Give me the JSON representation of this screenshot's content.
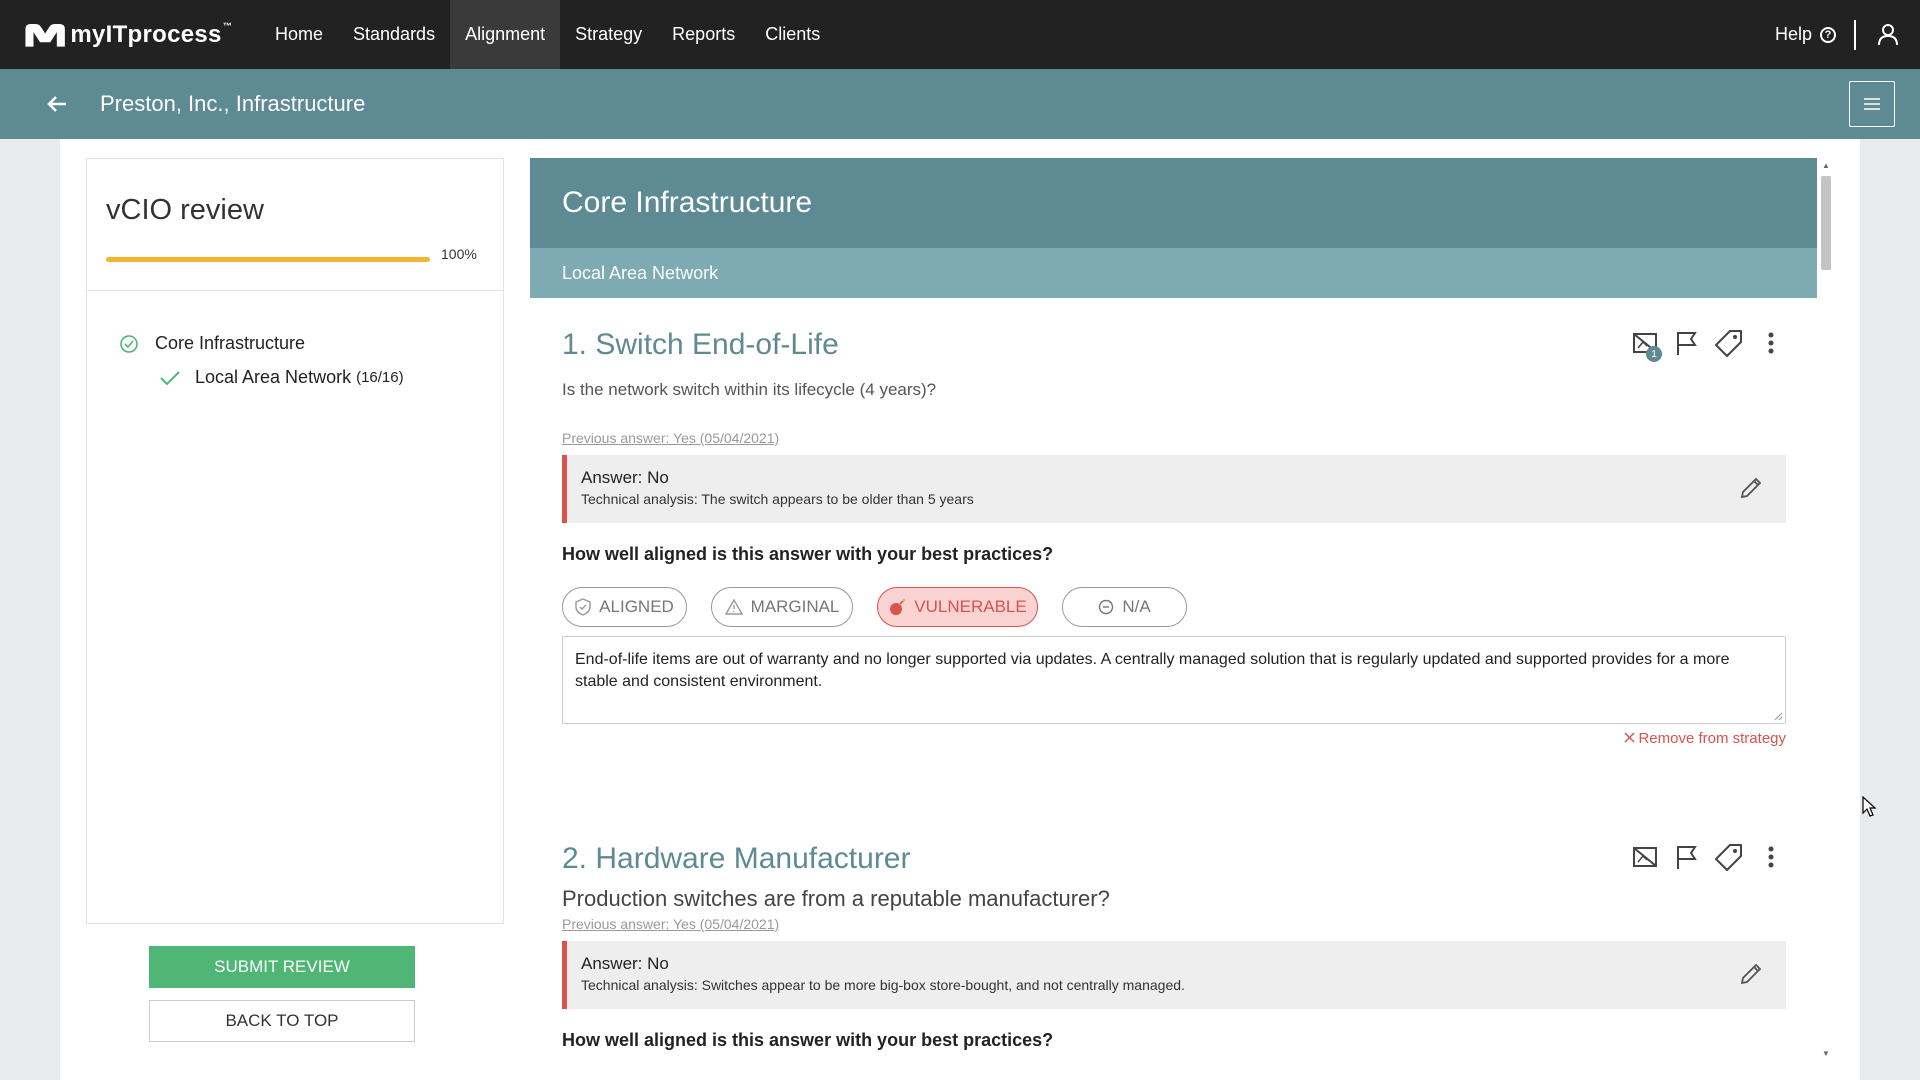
{
  "brand": {
    "name": "myITprocess",
    "tm": "™"
  },
  "nav": {
    "items": [
      {
        "label": "Home"
      },
      {
        "label": "Standards"
      },
      {
        "label": "Alignment"
      },
      {
        "label": "Strategy"
      },
      {
        "label": "Reports"
      },
      {
        "label": "Clients"
      }
    ],
    "active": "Alignment",
    "help_label": "Help"
  },
  "subheader": {
    "title": "Preston, Inc., Infrastructure"
  },
  "sidebar": {
    "title": "vCIO review",
    "progress_percent": 100,
    "progress_label": "100%",
    "tree": {
      "section": "Core Infrastructure",
      "item": "Local Area Network",
      "item_count": "(16/16)"
    },
    "submit_label": "SUBMIT REVIEW",
    "back_to_top_label": "BACK TO TOP"
  },
  "main": {
    "section_title": "Core Infrastructure",
    "subsection_title": "Local Area Network",
    "alignment_question": "How well aligned is this answer with your best practices?",
    "options": [
      "ALIGNED",
      "MARGINAL",
      "VULNERABLE",
      "N/A"
    ],
    "questions": [
      {
        "title": "1. Switch End-of-Life",
        "text": "Is the network switch within its lifecycle (4 years)?",
        "previous_answer": "Previous answer: Yes (05/04/2021)",
        "answer": "Answer: No",
        "analysis": "Technical analysis: The switch appears to be older than 5 years",
        "selected": "VULNERABLE",
        "notes": "End-of-life items are out of warranty and no longer supported via updates. A centrally managed solution that is regularly updated and supported provides for a more stable and consistent environment.",
        "remove_label": "Remove from strategy",
        "badge": "1"
      },
      {
        "title": "2. Hardware Manufacturer",
        "text": "Production switches are from a reputable manufacturer?",
        "previous_answer": "Previous answer: Yes (05/04/2021)",
        "answer": "Answer: No",
        "analysis": "Technical analysis: Switches appear to be more big-box store-bought, and not centrally managed."
      }
    ]
  },
  "colors": {
    "nav_bg": "#222222",
    "teal": "#5e8a93",
    "teal_light": "#7eaab3",
    "progress": "#f2b632",
    "submit": "#4fb676",
    "vulnerable": "#d9534f"
  },
  "icons": [
    "back-arrow-icon",
    "hamburger-icon",
    "help-icon",
    "user-icon",
    "check-circle-icon",
    "check-icon",
    "no-image-icon",
    "flag-icon",
    "tag-icon",
    "more-vertical-icon",
    "pencil-icon",
    "shield-icon",
    "warning-icon",
    "bomb-icon",
    "minus-circle-icon",
    "close-icon"
  ]
}
